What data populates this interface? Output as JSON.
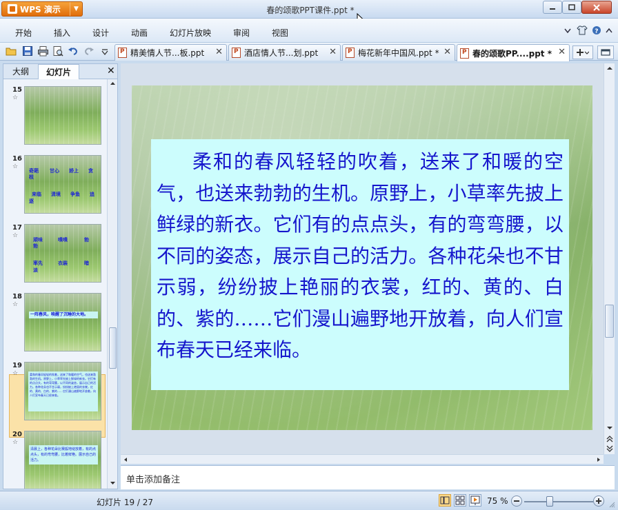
{
  "app": {
    "name": "WPS 演示",
    "document_title": "春的颂歌PPT课件.ppt *"
  },
  "menu": [
    "开始",
    "插入",
    "设计",
    "动画",
    "幻灯片放映",
    "审阅",
    "视图"
  ],
  "tabs": [
    {
      "label": "精美情人节...板.ppt",
      "active": false
    },
    {
      "label": "酒店情人节...划.ppt",
      "active": false
    },
    {
      "label": "梅花新年中国风.ppt *",
      "active": false
    },
    {
      "label": "春的颂歌PP....ppt *",
      "active": true
    }
  ],
  "left_panel": {
    "tab_outline": "大纲",
    "tab_slides": "幻灯片",
    "slides": [
      {
        "number": "15",
        "text": []
      },
      {
        "number": "16",
        "text": [
          "奇葩",
          "甘心",
          "娇上",
          "贪",
          "枝",
          "来临",
          "清境",
          "争鱼",
          "追",
          "逐"
        ]
      },
      {
        "number": "17",
        "text": [
          "顽味",
          "嗅嗅",
          "勃",
          "勃",
          "率先",
          "衣装",
          "暗",
          "淡"
        ]
      },
      {
        "number": "18",
        "text": [
          "一阵春风，唤醒了沉睡的大地。"
        ]
      },
      {
        "number": "19",
        "text": [
          "柔和的春风轻轻的吹着，送来了和暖的空气，也送来勃勃的生机。原野上，小草率先披上鲜绿的新衣。它们有的点点头，有的弯弯腰，以不同的姿态，展示自己的活力。各种花朵也不甘示弱，纷纷披上艳丽的衣裳，红的、黄的、白的、紫的……它们漫山遍野地开放着，向人们宣布春天已经来临。"
        ],
        "selected": true
      },
      {
        "number": "20",
        "text": [
          "清晨上，各种花朵比赛般地绽放着，有的点点头，有的弯弯腰，比着鲜艳。展示自己的活力。"
        ]
      }
    ]
  },
  "slide": {
    "body": "柔和的春风轻轻的吹着，送来了和暖的空气，也送来勃勃的生机。原野上，小草率先披上鲜绿的新衣。它们有的点点头，有的弯弯腰，以不同的姿态，展示自己的活力。各种花朵也不甘示弱，纷纷披上艳丽的衣裳，红的、黄的、白的、紫的……它们漫山遍野地开放着，向人们宣布春天已经来临。",
    "text_color": "#1515cc",
    "box_color": "#ccfdfd"
  },
  "notes_placeholder": "单击添加备注",
  "status": {
    "slide_indicator": "幻灯片 19 / 27",
    "zoom": "75 %",
    "zoom_level_percent": 75
  }
}
